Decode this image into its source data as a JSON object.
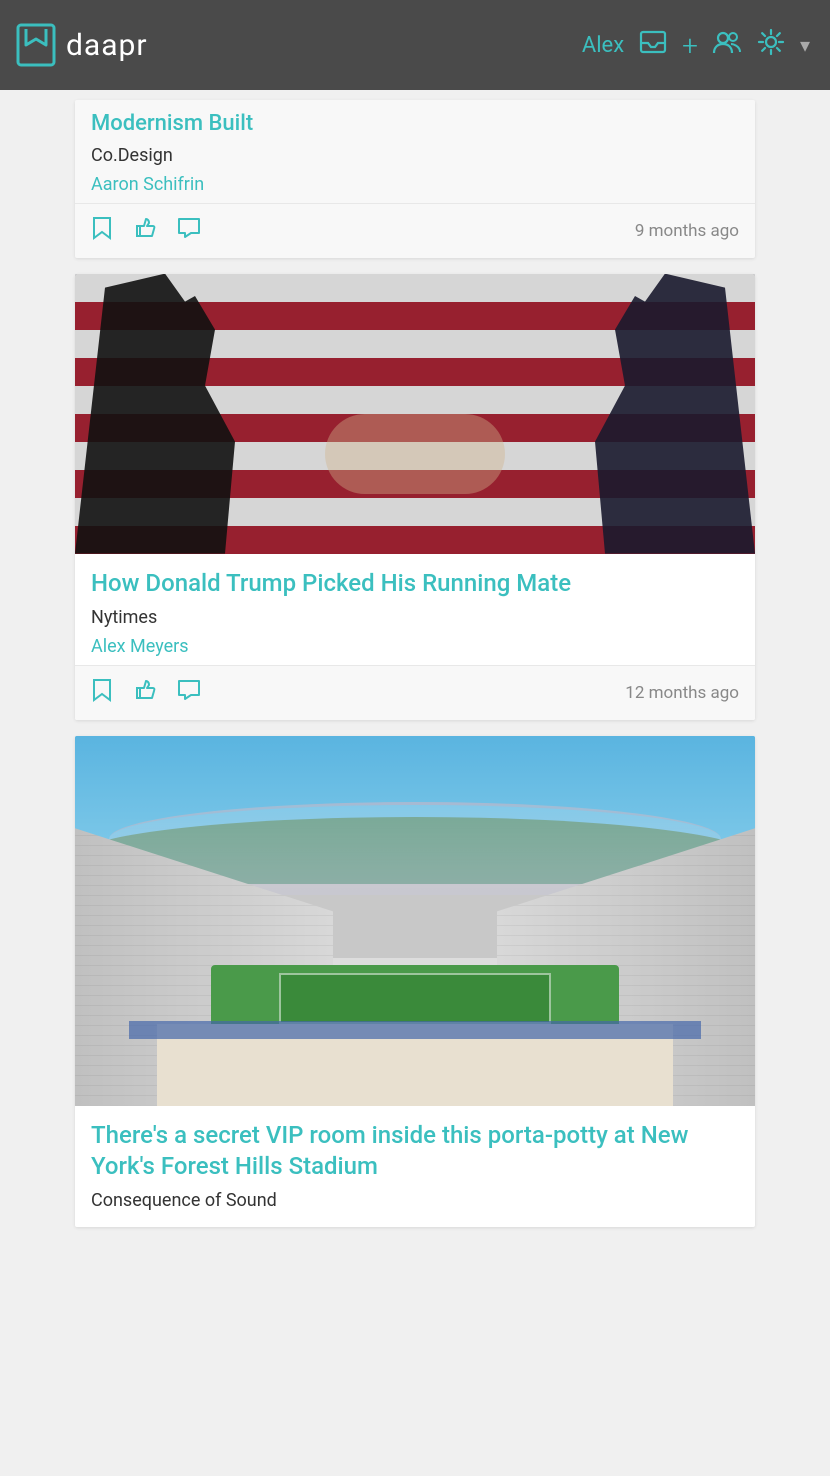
{
  "header": {
    "logo_text": "daapr",
    "username": "Alex",
    "nav_icons": [
      "inbox",
      "add",
      "users",
      "settings",
      "chevron"
    ]
  },
  "cards": [
    {
      "id": "card-partial-top",
      "type": "partial",
      "title": "Modernism Built",
      "source": "Co.Design",
      "author": "Aaron Schifrin",
      "time": "9 months ago"
    },
    {
      "id": "card-trump",
      "type": "full",
      "title": "How Donald Trump Picked His Running Mate",
      "source": "Nytimes",
      "author": "Alex Meyers",
      "time": "12 months ago"
    },
    {
      "id": "card-stadium",
      "type": "full",
      "title": "There's a secret VIP room inside this porta-potty at New York's Forest Hills Stadium",
      "source": "Consequence of Sound",
      "author": "",
      "time": ""
    }
  ],
  "actions": {
    "save_icon": "🔖",
    "like_icon": "👍",
    "comment_icon": "💬"
  }
}
